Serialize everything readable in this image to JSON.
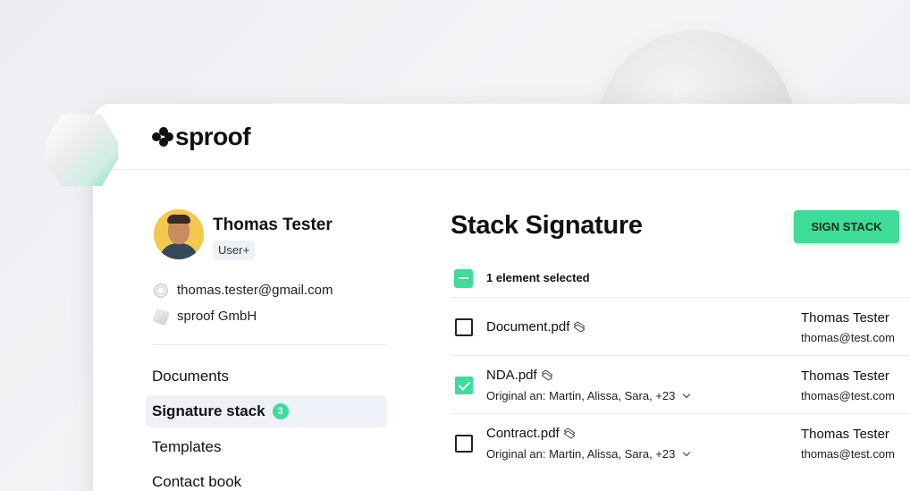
{
  "brand": {
    "name": "sproof"
  },
  "profile": {
    "name": "Thomas Tester",
    "role": "User+",
    "email": "thomas.tester@gmail.com",
    "company": "sproof GmbH"
  },
  "nav": {
    "items": [
      {
        "label": "Documents"
      },
      {
        "label": "Signature stack",
        "count": "3"
      },
      {
        "label": "Templates"
      },
      {
        "label": "Contact book"
      }
    ]
  },
  "main": {
    "title": "Stack Signature",
    "sign_button": "SIGN STACK",
    "selection_text": "1 element selected",
    "documents": [
      {
        "name": "Document.pdf",
        "checked": false,
        "owner": "Thomas Tester",
        "email": "thomas@test.com"
      },
      {
        "name": "NDA.pdf",
        "checked": true,
        "original": "Original an: Martin, Alissa, Sara, +23",
        "owner": "Thomas Tester",
        "email": "thomas@test.com"
      },
      {
        "name": "Contract.pdf",
        "checked": false,
        "original": "Original an: Martin, Alissa, Sara, +23",
        "owner": "Thomas Tester",
        "email": "thomas@test.com"
      }
    ]
  },
  "colors": {
    "accent": "#3ddc97",
    "active_nav_bg": "#eef2f8"
  }
}
